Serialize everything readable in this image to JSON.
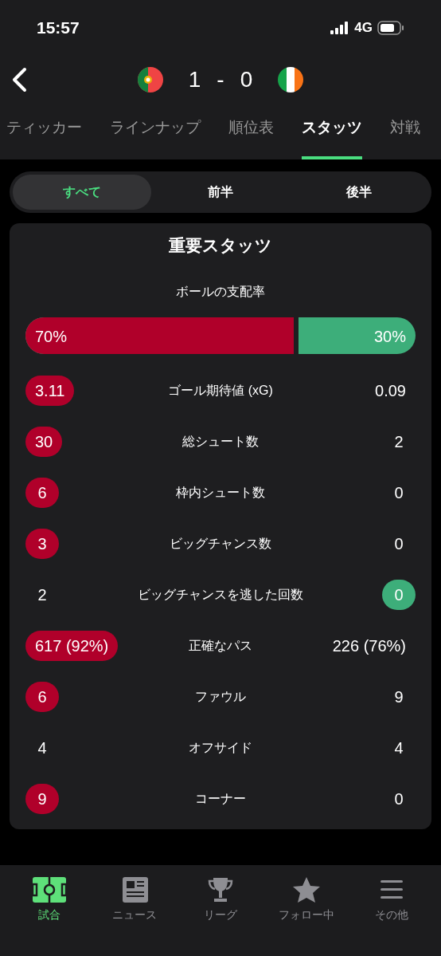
{
  "status_bar": {
    "time": "15:57",
    "network": "4G"
  },
  "match": {
    "home_score": "1",
    "separator": "-",
    "away_score": "0"
  },
  "tabs": [
    {
      "label": "ティッカー",
      "selected": false
    },
    {
      "label": "ラインナップ",
      "selected": false
    },
    {
      "label": "順位表",
      "selected": false
    },
    {
      "label": "スタッツ",
      "selected": true
    },
    {
      "label": "対戦",
      "selected": false
    }
  ],
  "periods": [
    {
      "label": "すべて",
      "selected": true
    },
    {
      "label": "前半",
      "selected": false
    },
    {
      "label": "後半",
      "selected": false
    }
  ],
  "card": {
    "title": "重要スタッツ",
    "possession": {
      "label": "ボールの支配率",
      "home": "70%",
      "away": "30%",
      "level": 0.7
    },
    "rows": [
      {
        "home": "3.11",
        "label": "ゴール期待値 (xG)",
        "away": "0.09",
        "home_highlighted": true,
        "away_highlighted": false
      },
      {
        "home": "30",
        "label": "総シュート数",
        "away": "2",
        "home_highlighted": true,
        "away_highlighted": false
      },
      {
        "home": "6",
        "label": "枠内シュート数",
        "away": "0",
        "home_highlighted": true,
        "away_highlighted": false
      },
      {
        "home": "3",
        "label": "ビッグチャンス数",
        "away": "0",
        "home_highlighted": true,
        "away_highlighted": false
      },
      {
        "home": "2",
        "label": "ビッグチャンスを逃した回数",
        "away": "0",
        "home_highlighted": false,
        "away_highlighted": true
      },
      {
        "home": "617 (92%)",
        "label": "正確なパス",
        "away": "226 (76%)",
        "home_highlighted": true,
        "away_highlighted": false
      },
      {
        "home": "6",
        "label": "ファウル",
        "away": "9",
        "home_highlighted": true,
        "away_highlighted": false
      },
      {
        "home": "4",
        "label": "オフサイド",
        "away": "4",
        "home_highlighted": false,
        "away_highlighted": false
      },
      {
        "home": "9",
        "label": "コーナー",
        "away": "0",
        "home_highlighted": true,
        "away_highlighted": false
      }
    ]
  },
  "bottom_nav": [
    {
      "label": "試合",
      "selected": true
    },
    {
      "label": "ニュース",
      "selected": false
    },
    {
      "label": "リーグ",
      "selected": false
    },
    {
      "label": "フォロー中",
      "selected": false
    },
    {
      "label": "その他",
      "selected": false
    }
  ]
}
